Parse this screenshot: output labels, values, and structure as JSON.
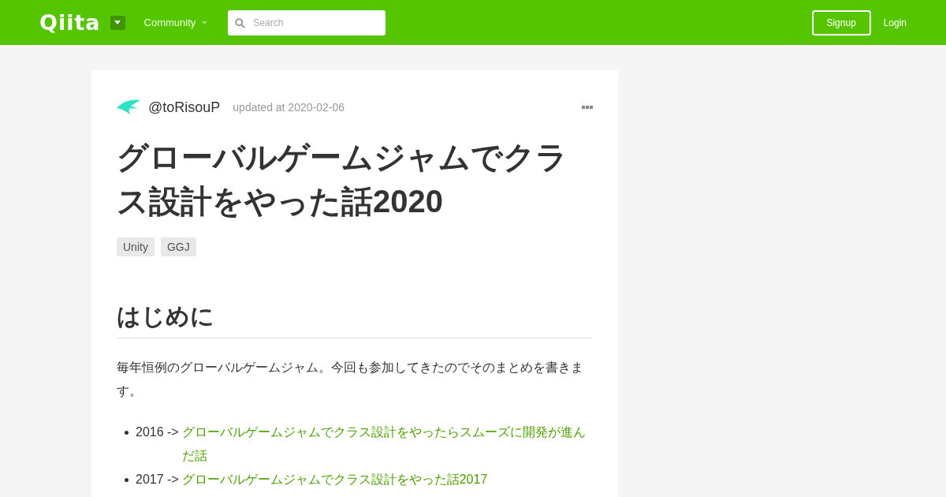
{
  "header": {
    "logo": "Qiita",
    "community": "Community",
    "search": {
      "placeholder": "Search"
    },
    "signup": "Signup",
    "login": "Login"
  },
  "article": {
    "author": "@toRisouP",
    "updated": "updated at 2020-02-06",
    "title": "グローバルゲームジャムでクラス設計をやった話2020",
    "tags": [
      "Unity",
      "GGJ"
    ],
    "heading": "はじめに",
    "paragraph": "毎年恒例のグローバルゲームジャム。今回も参加してきたのでそのまとめを書きます。",
    "list": [
      {
        "prefix": "2016 ->",
        "link": "グローバルゲームジャムでクラス設計をやったらスムーズに開発が進んだ話"
      },
      {
        "prefix": "2017 ->",
        "link": "グローバルゲームジャムでクラス設計をやった話2017"
      }
    ]
  }
}
